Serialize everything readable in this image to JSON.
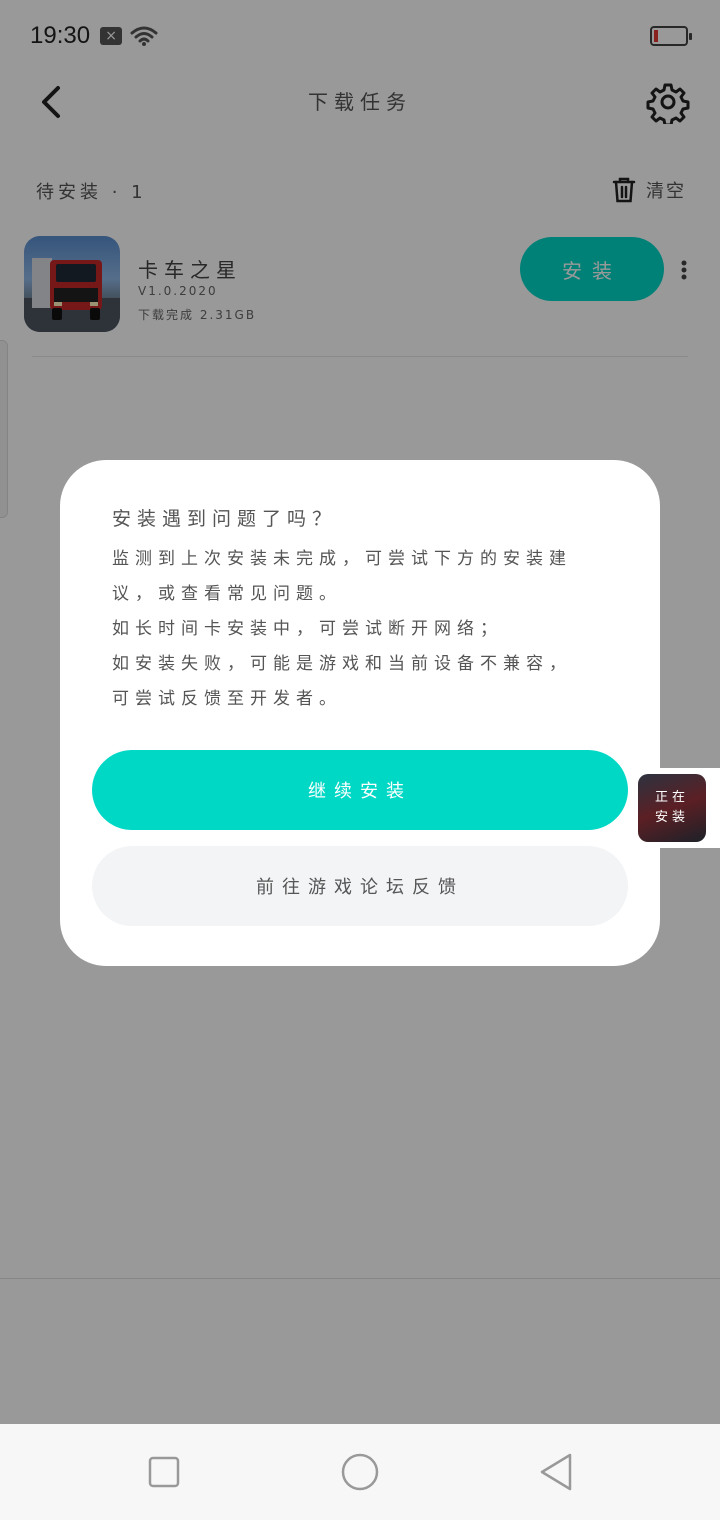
{
  "status_bar": {
    "time": "19:30",
    "sim_glyph": "×"
  },
  "header": {
    "title": "下载任务"
  },
  "section": {
    "title": "待安装 · 1",
    "clear_label": "清空"
  },
  "download_item": {
    "name": "卡车之星",
    "version": "V1.0.2020",
    "status": "下载完成   2.31GB",
    "install_label": "安装"
  },
  "dialog": {
    "title": "安装遇到问题了吗？",
    "lines": [
      "监测到上次安装未完成，可尝试下方的安装建",
      "议，或查看常见问题。",
      "如长时间卡安装中，可尝试断开网络；",
      "如安装失败，可能是游戏和当前设备不兼容，",
      "可尝试反馈至开发者。"
    ],
    "continue_label": "继续安装",
    "forum_label": "前往游戏论坛反馈"
  },
  "floating_widget": {
    "label_line1": "正在",
    "label_line2": "安装"
  },
  "colors": {
    "accent": "#00d8c6",
    "overlay": "rgba(0,0,0,0.4)",
    "battery_low": "#e53935"
  },
  "icons": [
    "back-arrow-icon",
    "gear-icon",
    "trash-icon",
    "more-vertical-icon",
    "wifi-icon",
    "battery-icon",
    "square-icon",
    "circle-icon",
    "triangle-back-icon"
  ]
}
